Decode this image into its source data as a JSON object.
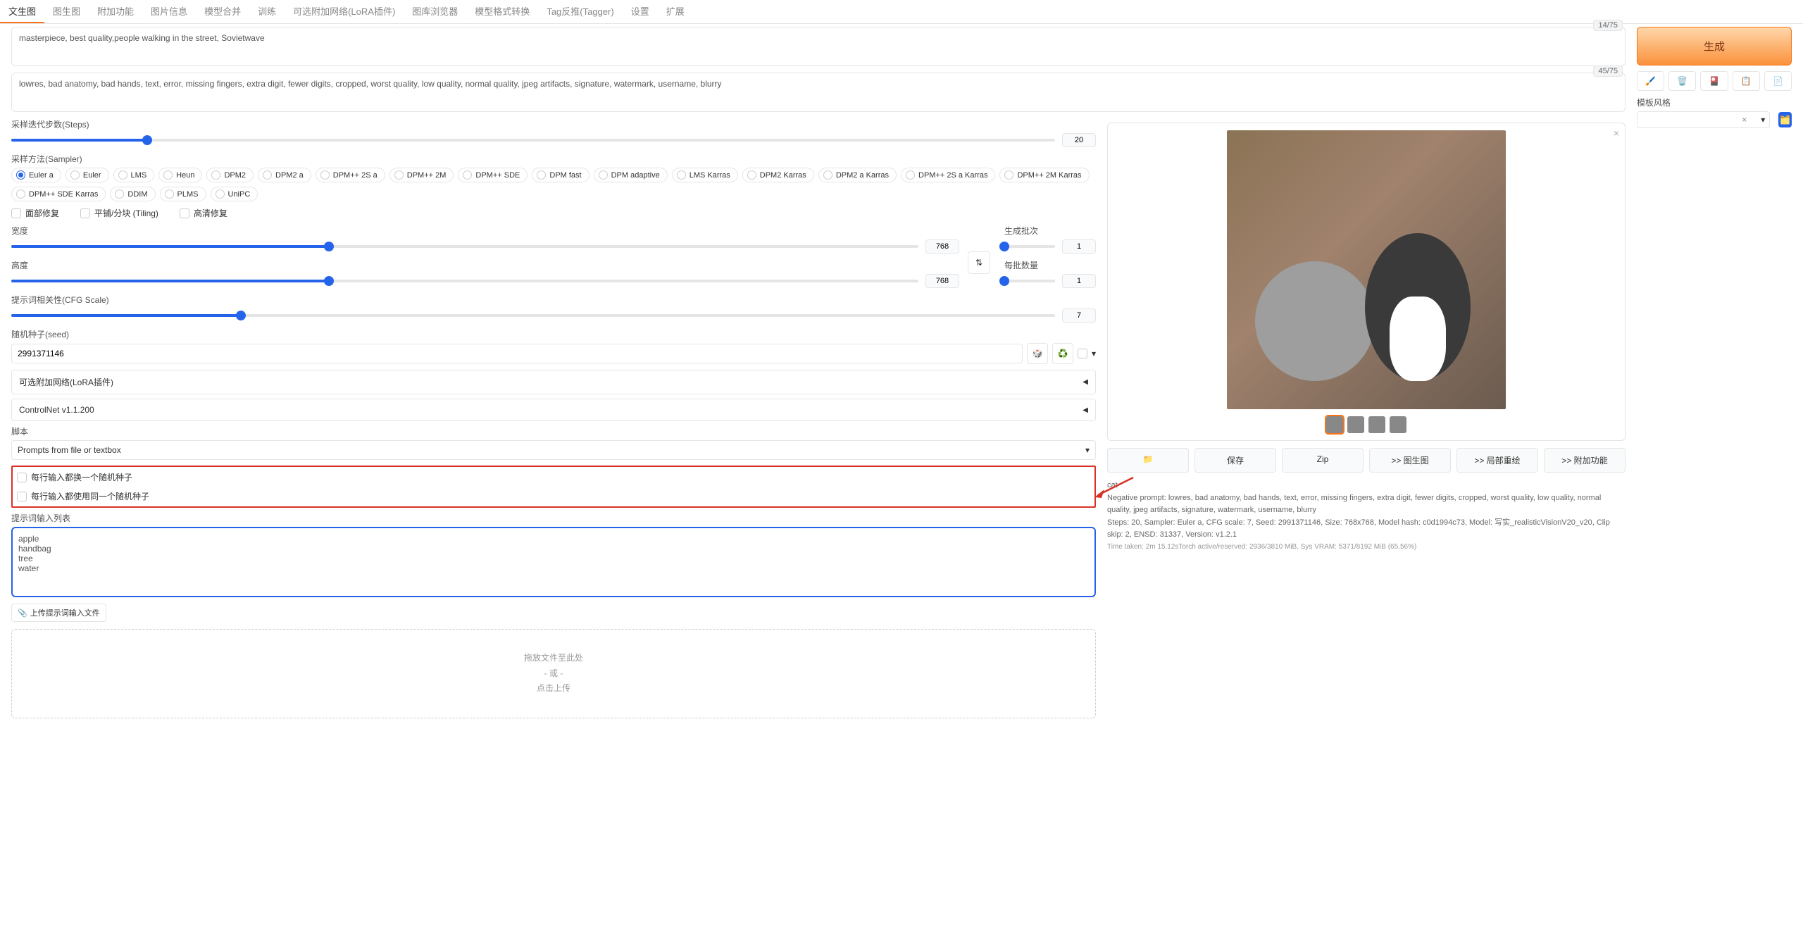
{
  "tabs": [
    "文生图",
    "图生图",
    "附加功能",
    "图片信息",
    "模型合并",
    "训练",
    "可选附加网络(LoRA插件)",
    "图库浏览器",
    "模型格式转换",
    "Tag反推(Tagger)",
    "设置",
    "扩展"
  ],
  "prompt": {
    "positive": "masterpiece, best quality,people walking in the street, Sovietwave",
    "negative": "lowres, bad anatomy, bad hands, text, error, missing fingers, extra digit, fewer digits, cropped, worst quality, low quality, normal quality, jpeg artifacts, signature, watermark, username, blurry",
    "pos_tokens": "14/75",
    "neg_tokens": "45/75"
  },
  "generate_label": "生成",
  "style_label": "模板风格",
  "style_x": "×",
  "steps": {
    "label": "采样迭代步数(Steps)",
    "value": "20",
    "pct": 13
  },
  "sampler": {
    "label": "采样方法(Sampler)",
    "options": [
      "Euler a",
      "Euler",
      "LMS",
      "Heun",
      "DPM2",
      "DPM2 a",
      "DPM++ 2S a",
      "DPM++ 2M",
      "DPM++ SDE",
      "DPM fast",
      "DPM adaptive",
      "LMS Karras",
      "DPM2 Karras",
      "DPM2 a Karras",
      "DPM++ 2S a Karras",
      "DPM++ 2M Karras",
      "DPM++ SDE Karras",
      "DDIM",
      "PLMS",
      "UniPC"
    ],
    "selected": "Euler a"
  },
  "checks": {
    "face": "面部修复",
    "tiling": "平铺/分块 (Tiling)",
    "hires": "高清修复"
  },
  "width": {
    "label": "宽度",
    "value": "768",
    "pct": 35
  },
  "height": {
    "label": "高度",
    "value": "768",
    "pct": 35
  },
  "batch_count": {
    "label": "生成批次",
    "value": "1"
  },
  "batch_size": {
    "label": "每批数量",
    "value": "1"
  },
  "cfg": {
    "label": "提示词相关性(CFG Scale)",
    "value": "7",
    "pct": 22
  },
  "seed": {
    "label": "随机种子(seed)",
    "value": "2991371146",
    "dice": "🎲",
    "recycle": "♻️"
  },
  "lora": "可选附加网络(LoRA插件)",
  "controlnet": "ControlNet v1.1.200",
  "script": {
    "label": "脚本",
    "selected": "Prompts from file or textbox"
  },
  "script_opts": {
    "iterate": "每行输入都换一个随机种子",
    "same": "每行输入都使用同一个随机种子"
  },
  "list_label": "提示词输入列表",
  "list_value": "apple\nhandbag\ntree\nwater",
  "upload_btn": "上传提示词输入文件",
  "dropzone": {
    "l1": "拖放文件至此处",
    "l2": "- 或 -",
    "l3": "点击上传"
  },
  "actions": {
    "folder": "📁",
    "save": "保存",
    "zip": "Zip",
    "img2img": ">> 图生图",
    "inpaint": ">> 局部重绘",
    "extras": ">> 附加功能"
  },
  "meta": {
    "prompt_line": "cat",
    "neg_line": "Negative prompt: lowres, bad anatomy, bad hands, text, error, missing fingers, extra digit, fewer digits, cropped, worst quality, low quality, normal quality, jpeg artifacts, signature, watermark, username, blurry",
    "params": "Steps: 20, Sampler: Euler a, CFG scale: 7, Seed: 2991371146, Size: 768x768, Model hash: c0d1994c73, Model: 写实_realisticVisionV20_v20, Clip skip: 2, ENSD: 31337, Version: v1.2.1",
    "time": "Time taken: 2m 15.12sTorch active/reserved: 2936/3810 MiB, Sys VRAM: 5371/8192 MiB (65.56%)"
  },
  "icons": {
    "paint": "🖌️",
    "trash": "🗑️",
    "card": "🎴",
    "clip": "📋",
    "file": "📄",
    "doc": "🗂️",
    "swap": "⇅",
    "chev": "▾",
    "tri": "◀",
    "up": "📎"
  }
}
